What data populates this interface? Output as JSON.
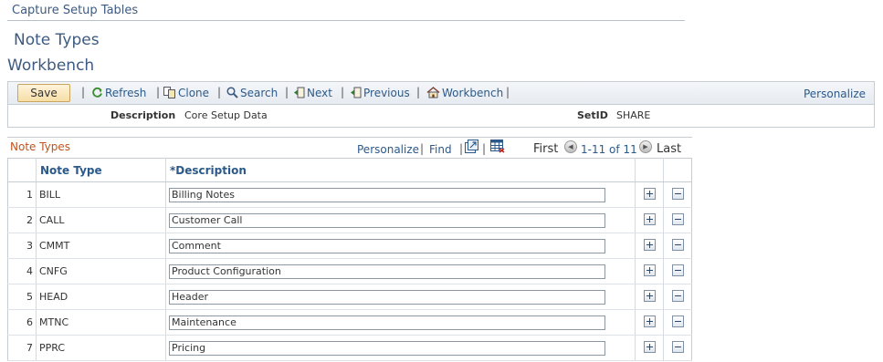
{
  "breadcrumb": "Capture Setup Tables",
  "page_subtitle": "Note Types",
  "page_title": "Workbench",
  "toolbar": {
    "save_label": "Save",
    "refresh_label": "Refresh",
    "clone_label": "Clone",
    "search_label": "Search",
    "next_label": "Next",
    "previous_label": "Previous",
    "workbench_label": "Workbench",
    "personalize_label": "Personalize"
  },
  "header_info": {
    "description_label": "Description",
    "description_value": "Core Setup Data",
    "setid_label": "SetID",
    "setid_value": "SHARE"
  },
  "grid": {
    "title": "Note Types",
    "personalize_label": "Personalize",
    "find_label": "Find",
    "first_label": "First",
    "range_label": "1-11 of 11",
    "last_label": "Last",
    "columns": {
      "note_type": "Note Type",
      "description": "*Description"
    },
    "rows": [
      {
        "num": "1",
        "type": "BILL",
        "desc": "Billing Notes"
      },
      {
        "num": "2",
        "type": "CALL",
        "desc": "Customer Call"
      },
      {
        "num": "3",
        "type": "CMMT",
        "desc": "Comment"
      },
      {
        "num": "4",
        "type": "CNFG",
        "desc": "Product Configuration"
      },
      {
        "num": "5",
        "type": "HEAD",
        "desc": "Header"
      },
      {
        "num": "6",
        "type": "MTNC",
        "desc": "Maintenance"
      },
      {
        "num": "7",
        "type": "PPRC",
        "desc": "Pricing"
      }
    ]
  },
  "colors": {
    "link": "#2b5a8a",
    "grid_title": "#c0541d",
    "save_button": "#f6dea6"
  }
}
